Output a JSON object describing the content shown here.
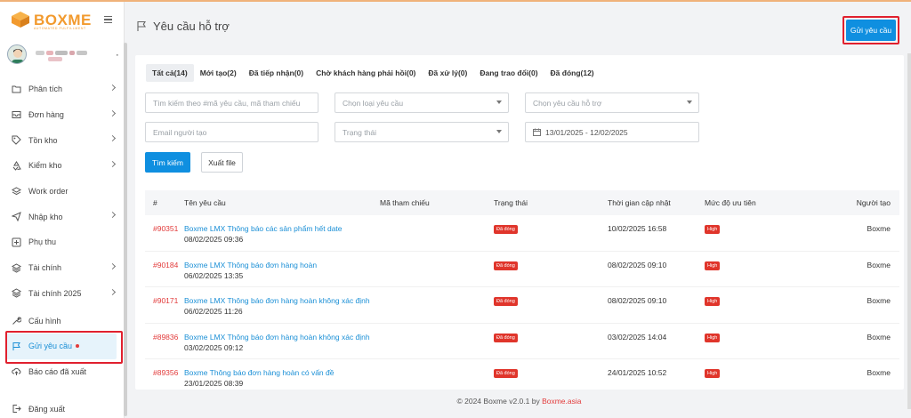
{
  "brand": {
    "logo_text": "BOXME",
    "logo_sub": "AUTOMATED FULFILLMENT"
  },
  "sidebar": {
    "items": [
      {
        "label": "Phân tích",
        "icon": "folder-icon",
        "chevron": true
      },
      {
        "label": "Đơn hàng",
        "icon": "inbox-icon",
        "chevron": true
      },
      {
        "label": "Tồn kho",
        "icon": "tag-icon",
        "chevron": true
      },
      {
        "label": "Kiểm kho",
        "icon": "recycle-icon",
        "chevron": true
      },
      {
        "label": "Work order",
        "icon": "layers-icon",
        "chevron": false
      },
      {
        "label": "Nhập kho",
        "icon": "plane-icon",
        "chevron": true
      },
      {
        "label": "Phụ thu",
        "icon": "plus-square-icon",
        "chevron": false
      },
      {
        "label": "Tài chính",
        "icon": "stack-icon",
        "chevron": true
      },
      {
        "label": "Tài chính 2025",
        "icon": "stack-icon",
        "chevron": true
      },
      {
        "label": "Cấu hình",
        "icon": "wrench-icon",
        "chevron": false
      },
      {
        "label": "Gửi yêu cầu",
        "icon": "flag-icon",
        "chevron": false,
        "active": true
      },
      {
        "label": "Báo cáo đã xuất",
        "icon": "cloud-upload-icon",
        "chevron": false
      }
    ],
    "logout_label": "Đăng xuất"
  },
  "header": {
    "title": "Yêu cầu hỗ trợ",
    "send_button": "Gửi yêu cầu"
  },
  "tabs": [
    {
      "label": "Tất cả(14)",
      "active": true
    },
    {
      "label": "Mới tạo(2)"
    },
    {
      "label": "Đã tiếp nhận(0)"
    },
    {
      "label": "Chờ khách hàng phải hồi(0)"
    },
    {
      "label": "Đã xử lý(0)"
    },
    {
      "label": "Đang trao đổi(0)"
    },
    {
      "label": "Đã đóng(12)"
    }
  ],
  "filters": {
    "search_placeholder": "Tìm kiếm theo #mã yêu cầu, mã tham chiếu",
    "type_placeholder": "Chọn loại yêu cầu",
    "support_placeholder": "Chọn yêu cầu hỗ trợ",
    "email_placeholder": "Email người tạo",
    "status_placeholder": "Trạng thái",
    "date_range": "13/01/2025 - 12/02/2025",
    "search_button": "Tìm kiếm",
    "export_button": "Xuất file"
  },
  "table": {
    "headers": {
      "num": "#",
      "name": "Tên yêu cầu",
      "ref": "Mã tham chiếu",
      "status": "Trạng thái",
      "updated": "Thời gian cập nhật",
      "priority": "Mức độ ưu tiên",
      "creator": "Người tạo"
    },
    "rows": [
      {
        "id": "#90351",
        "name": "Boxme LMX Thông báo các sản phẩm hết date",
        "date": "08/02/2025 09:36",
        "status": "Đã đóng",
        "updated": "10/02/2025 16:58",
        "priority": "High",
        "creator": "Boxme"
      },
      {
        "id": "#90184",
        "name": "Boxme LMX Thông báo đơn hàng hoàn",
        "date": "06/02/2025 13:35",
        "status": "Đã đóng",
        "updated": "08/02/2025 09:10",
        "priority": "High",
        "creator": "Boxme"
      },
      {
        "id": "#90171",
        "name": "Boxme LMX Thông báo đơn hàng hoàn không xác định",
        "date": "06/02/2025 11:26",
        "status": "Đã đóng",
        "updated": "08/02/2025 09:10",
        "priority": "High",
        "creator": "Boxme"
      },
      {
        "id": "#89836",
        "name": "Boxme LMX Thông báo đơn hàng hoàn không xác định",
        "date": "03/02/2025 09:12",
        "status": "Đã đóng",
        "updated": "03/02/2025 14:04",
        "priority": "High",
        "creator": "Boxme"
      },
      {
        "id": "#89356",
        "name": "Boxme Thông báo đơn hàng hoàn có vấn đề",
        "date": "23/01/2025 08:39",
        "status": "Đã đóng",
        "updated": "24/01/2025 10:52",
        "priority": "High",
        "creator": "Boxme"
      }
    ]
  },
  "footer": {
    "text": "© 2024 Boxme v2.0.1 by ",
    "brand": "Boxme.asia"
  },
  "colors": {
    "primary": "#0f8fe0",
    "danger": "#e0352b",
    "highlight": "#e0202e",
    "brand": "#f29a2e"
  }
}
